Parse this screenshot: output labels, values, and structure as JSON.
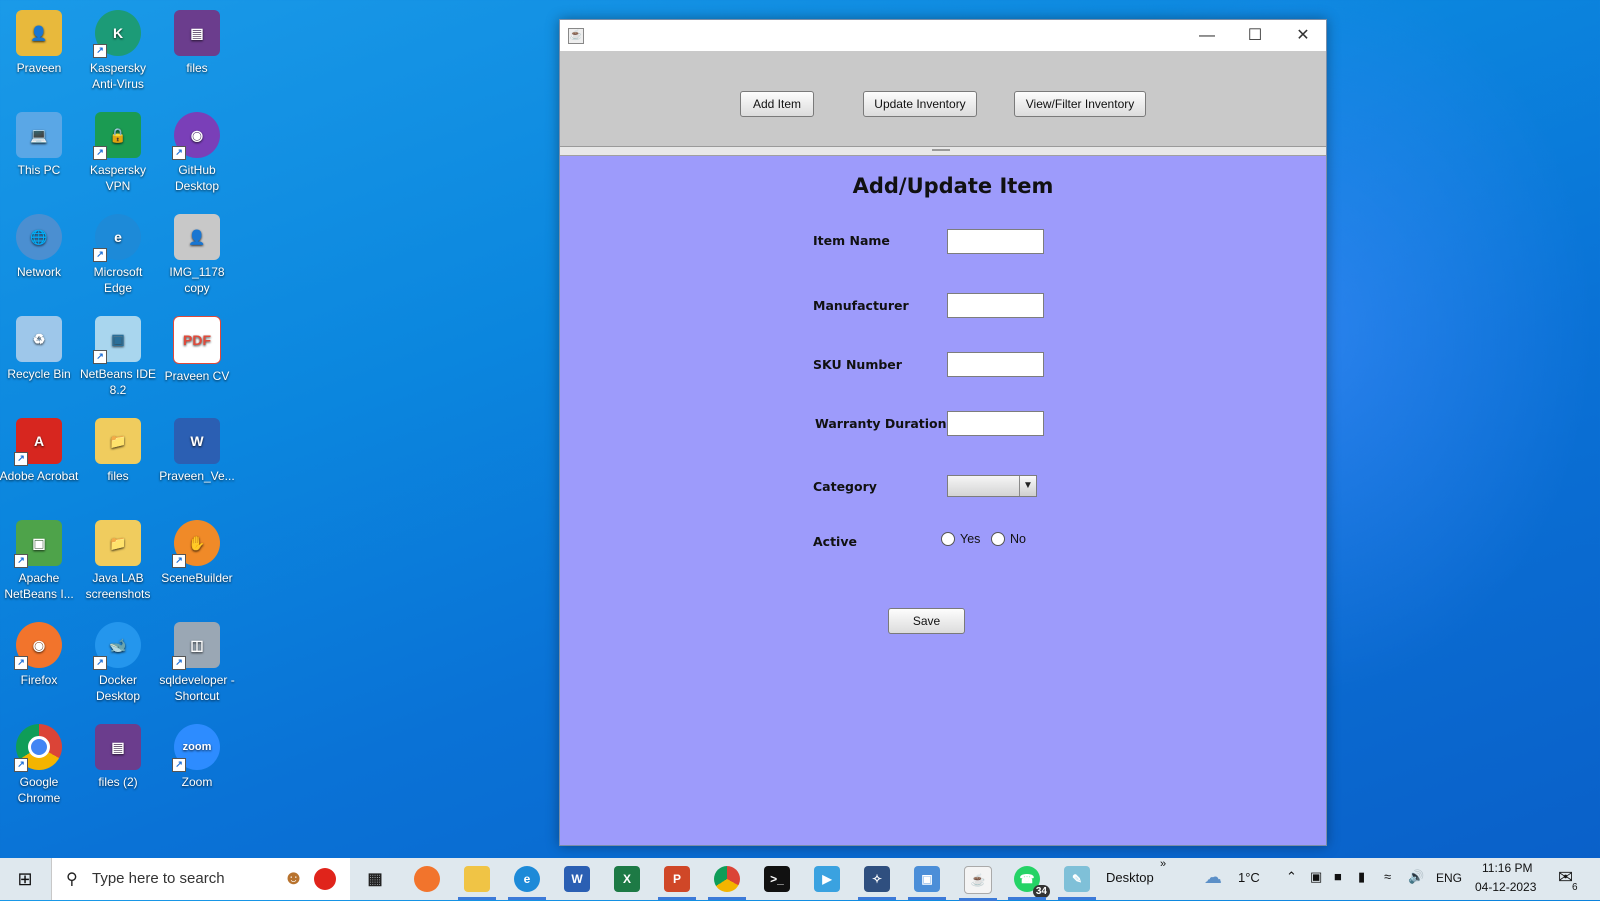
{
  "desktop": {
    "icons": [
      {
        "label": "Praveen",
        "icon": "user-folder-icon",
        "color": "#e8b93c"
      },
      {
        "label": "Kaspersky Anti-Virus",
        "icon": "kaspersky-icon",
        "color": "#1c9b77"
      },
      {
        "label": "files",
        "icon": "winrar-icon",
        "color": "#6b3d8d"
      },
      {
        "label": "This PC",
        "icon": "computer-icon",
        "color": "#5aa7e6"
      },
      {
        "label": "Kaspersky VPN",
        "icon": "vpn-shield-icon",
        "color": "#1b9b52"
      },
      {
        "label": "GitHub Desktop",
        "icon": "github-icon",
        "color": "#7a3fb8"
      },
      {
        "label": "Network",
        "icon": "network-icon",
        "color": "#4b8fd1"
      },
      {
        "label": "Microsoft Edge",
        "icon": "edge-icon",
        "color": "#1d8ad8"
      },
      {
        "label": "IMG_1178 copy",
        "icon": "photo-icon",
        "color": "#c8c8c8"
      },
      {
        "label": "Recycle Bin",
        "icon": "recycle-bin-icon",
        "color": "#9ec7ea"
      },
      {
        "label": "NetBeans IDE 8.2",
        "icon": "netbeans-cube-icon",
        "color": "#a9d6ee"
      },
      {
        "label": "Praveen CV",
        "icon": "pdf-icon",
        "color": "#e04a3a"
      },
      {
        "label": "Adobe Acrobat",
        "icon": "acrobat-icon",
        "color": "#d7261f"
      },
      {
        "label": "files",
        "icon": "folder-icon",
        "color": "#f0cc5e"
      },
      {
        "label": "Praveen_Ve...",
        "icon": "word-doc-icon",
        "color": "#2b5fb3"
      },
      {
        "label": "Apache NetBeans I...",
        "icon": "netbeans-icon",
        "color": "#4ea34a"
      },
      {
        "label": "Java LAB screenshots",
        "icon": "folder-icon",
        "color": "#f0cc5e"
      },
      {
        "label": "SceneBuilder",
        "icon": "scenebuilder-icon",
        "color": "#f08a28"
      },
      {
        "label": "Firefox",
        "icon": "firefox-icon",
        "color": "#f2742c"
      },
      {
        "label": "Docker Desktop",
        "icon": "docker-icon",
        "color": "#2496ed"
      },
      {
        "label": "sqldeveloper - Shortcut",
        "icon": "sqldeveloper-icon",
        "color": "#9aa7b4"
      },
      {
        "label": "Google Chrome",
        "icon": "chrome-icon",
        "color": "#db4437"
      },
      {
        "label": "files (2)",
        "icon": "winrar-icon",
        "color": "#6b3d8d"
      },
      {
        "label": "Zoom",
        "icon": "zoom-icon",
        "color": "#2d8cff"
      }
    ]
  },
  "window": {
    "title": "",
    "controls": {
      "minimize": "—",
      "maximize": "☐",
      "close": "✕"
    },
    "toolbar": {
      "add_item": "Add Item",
      "update_inventory": "Update Inventory",
      "view_filter_inventory": "View/Filter Inventory"
    },
    "form": {
      "title": "Add/Update Item",
      "item_name_label": "Item Name",
      "item_name_value": "",
      "manufacturer_label": "Manufacturer",
      "manufacturer_value": "",
      "sku_label": "SKU Number",
      "sku_value": "",
      "warranty_label": "Warranty Duration",
      "warranty_value": "",
      "category_label": "Category",
      "category_value": "",
      "active_label": "Active",
      "active_yes": "Yes",
      "active_no": "No",
      "save_label": "Save",
      "panel_color": "#9d9bfb"
    }
  },
  "taskbar": {
    "search_placeholder": "Type here to search",
    "desktop_label": "Desktop",
    "weather": "1°C",
    "language": "ENG",
    "time": "11:16 PM",
    "date": "04-12-2023",
    "whatsapp_badge": "34",
    "notification_badge": "6"
  }
}
